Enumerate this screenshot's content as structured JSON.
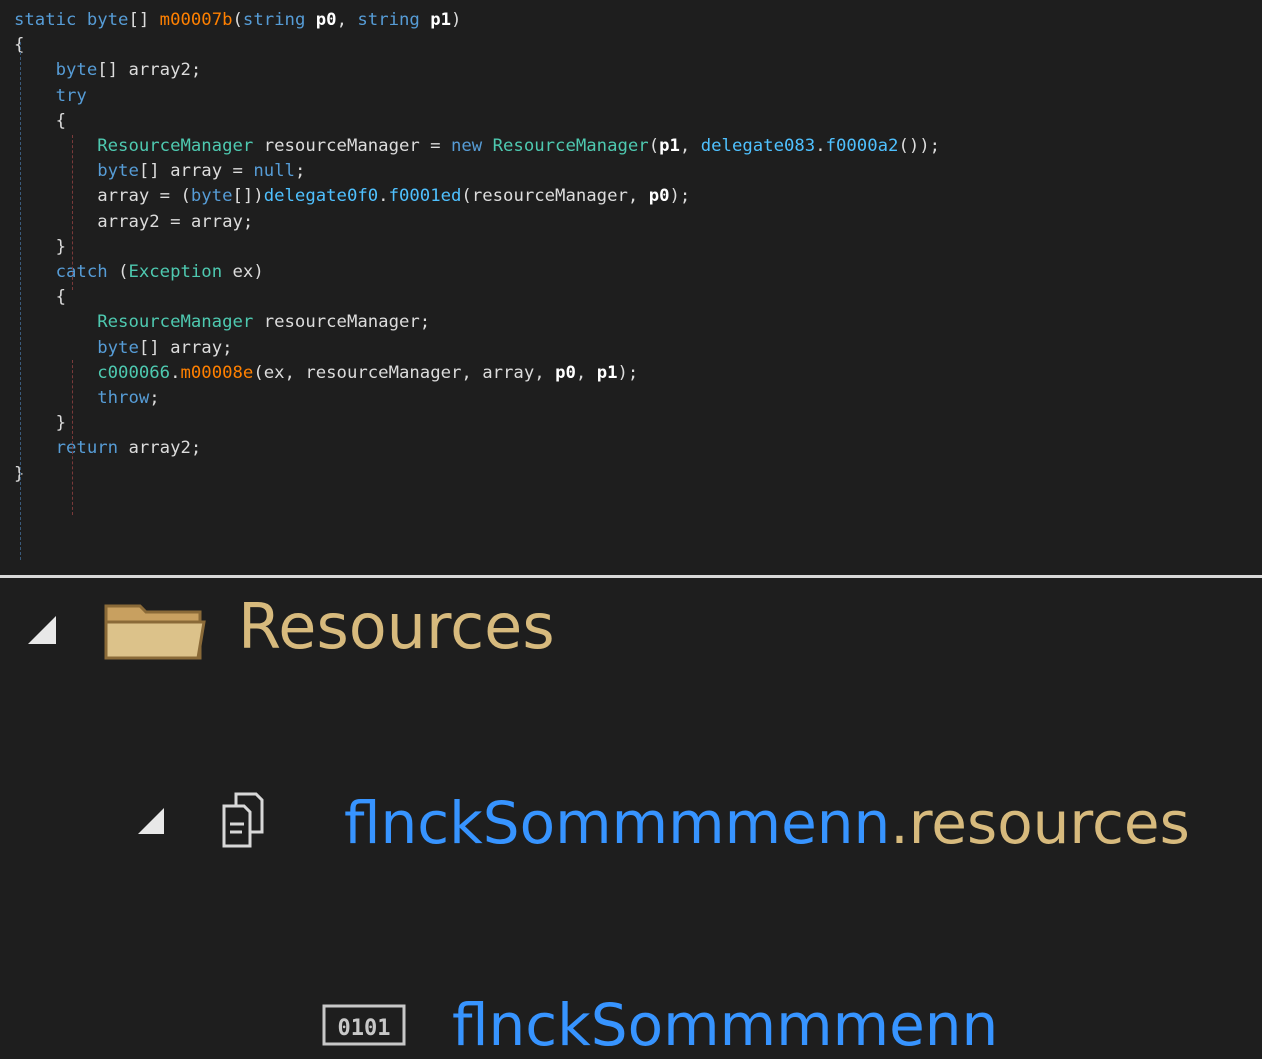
{
  "code": {
    "lines": [
      [
        [
          "kw",
          "static byte"
        ],
        [
          "p",
          "[] "
        ],
        [
          "mt",
          "m00007b"
        ],
        [
          "p",
          "("
        ],
        [
          "kw",
          "string "
        ],
        [
          "pb",
          "p0"
        ],
        [
          "p",
          ", "
        ],
        [
          "kw",
          "string "
        ],
        [
          "pb",
          "p1"
        ],
        [
          "p",
          ")"
        ]
      ],
      [
        [
          "p",
          "{"
        ]
      ],
      [
        [
          "p",
          "    "
        ],
        [
          "kw",
          "byte"
        ],
        [
          "p",
          "[] array2;"
        ]
      ],
      [
        [
          "p",
          "    "
        ],
        [
          "kw",
          "try"
        ]
      ],
      [
        [
          "p",
          "    {"
        ]
      ],
      [
        [
          "p",
          "        "
        ],
        [
          "ty",
          "ResourceManager"
        ],
        [
          "p",
          " resourceManager = "
        ],
        [
          "kw",
          "new "
        ],
        [
          "ty",
          "ResourceManager"
        ],
        [
          "p",
          "("
        ],
        [
          "pb",
          "p1"
        ],
        [
          "p",
          ", "
        ],
        [
          "fn",
          "delegate083"
        ],
        [
          "p",
          "."
        ],
        [
          "fld",
          "f0000a2"
        ],
        [
          "p",
          "());"
        ]
      ],
      [
        [
          "p",
          "        "
        ],
        [
          "kw",
          "byte"
        ],
        [
          "p",
          "[] array = "
        ],
        [
          "kw",
          "null"
        ],
        [
          "p",
          ";"
        ]
      ],
      [
        [
          "p",
          "        array = ("
        ],
        [
          "kw",
          "byte"
        ],
        [
          "p",
          "[])"
        ],
        [
          "fn",
          "delegate0f0"
        ],
        [
          "p",
          "."
        ],
        [
          "fld",
          "f0001ed"
        ],
        [
          "p",
          "(resourceManager, "
        ],
        [
          "pb",
          "p0"
        ],
        [
          "p",
          ");"
        ]
      ],
      [
        [
          "p",
          "        array2 = array;"
        ]
      ],
      [
        [
          "p",
          "    }"
        ]
      ],
      [
        [
          "p",
          "    "
        ],
        [
          "kw",
          "catch "
        ],
        [
          "p",
          "("
        ],
        [
          "ty",
          "Exception"
        ],
        [
          "p",
          " ex)"
        ]
      ],
      [
        [
          "p",
          "    {"
        ]
      ],
      [
        [
          "p",
          "        "
        ],
        [
          "ty",
          "ResourceManager"
        ],
        [
          "p",
          " resourceManager;"
        ]
      ],
      [
        [
          "p",
          "        "
        ],
        [
          "kw",
          "byte"
        ],
        [
          "p",
          "[] array;"
        ]
      ],
      [
        [
          "p",
          "        "
        ],
        [
          "ty",
          "c000066"
        ],
        [
          "p",
          "."
        ],
        [
          "mt",
          "m00008e"
        ],
        [
          "p",
          "(ex, resourceManager, array, "
        ],
        [
          "pb",
          "p0"
        ],
        [
          "p",
          ", "
        ],
        [
          "pb",
          "p1"
        ],
        [
          "p",
          ");"
        ]
      ],
      [
        [
          "p",
          "        "
        ],
        [
          "kw",
          "throw"
        ],
        [
          "p",
          ";"
        ]
      ],
      [
        [
          "p",
          "    }"
        ]
      ],
      [
        [
          "p",
          "    "
        ],
        [
          "kw",
          "return"
        ],
        [
          "p",
          " array2;"
        ]
      ],
      [
        [
          "p",
          "}"
        ]
      ]
    ]
  },
  "tree": {
    "folder": {
      "label": "Resources",
      "icon": "folder-icon",
      "expanded": true
    },
    "file": {
      "label_main": "flnckSommmmenn",
      "label_ext": ".resources",
      "icon": "resource-file-icon",
      "expanded": true
    },
    "item": {
      "label": "flnckSommmmenn",
      "icon": "binary-icon"
    }
  },
  "colors": {
    "background": "#1e1e1e",
    "keyword": "#569cd6",
    "type": "#4ec9b0",
    "method": "#ff8000",
    "member": "#4fc1ff",
    "folder_label": "#d7ba7d",
    "file_label": "#3794ff",
    "ext_label": "#d7ba7d"
  }
}
